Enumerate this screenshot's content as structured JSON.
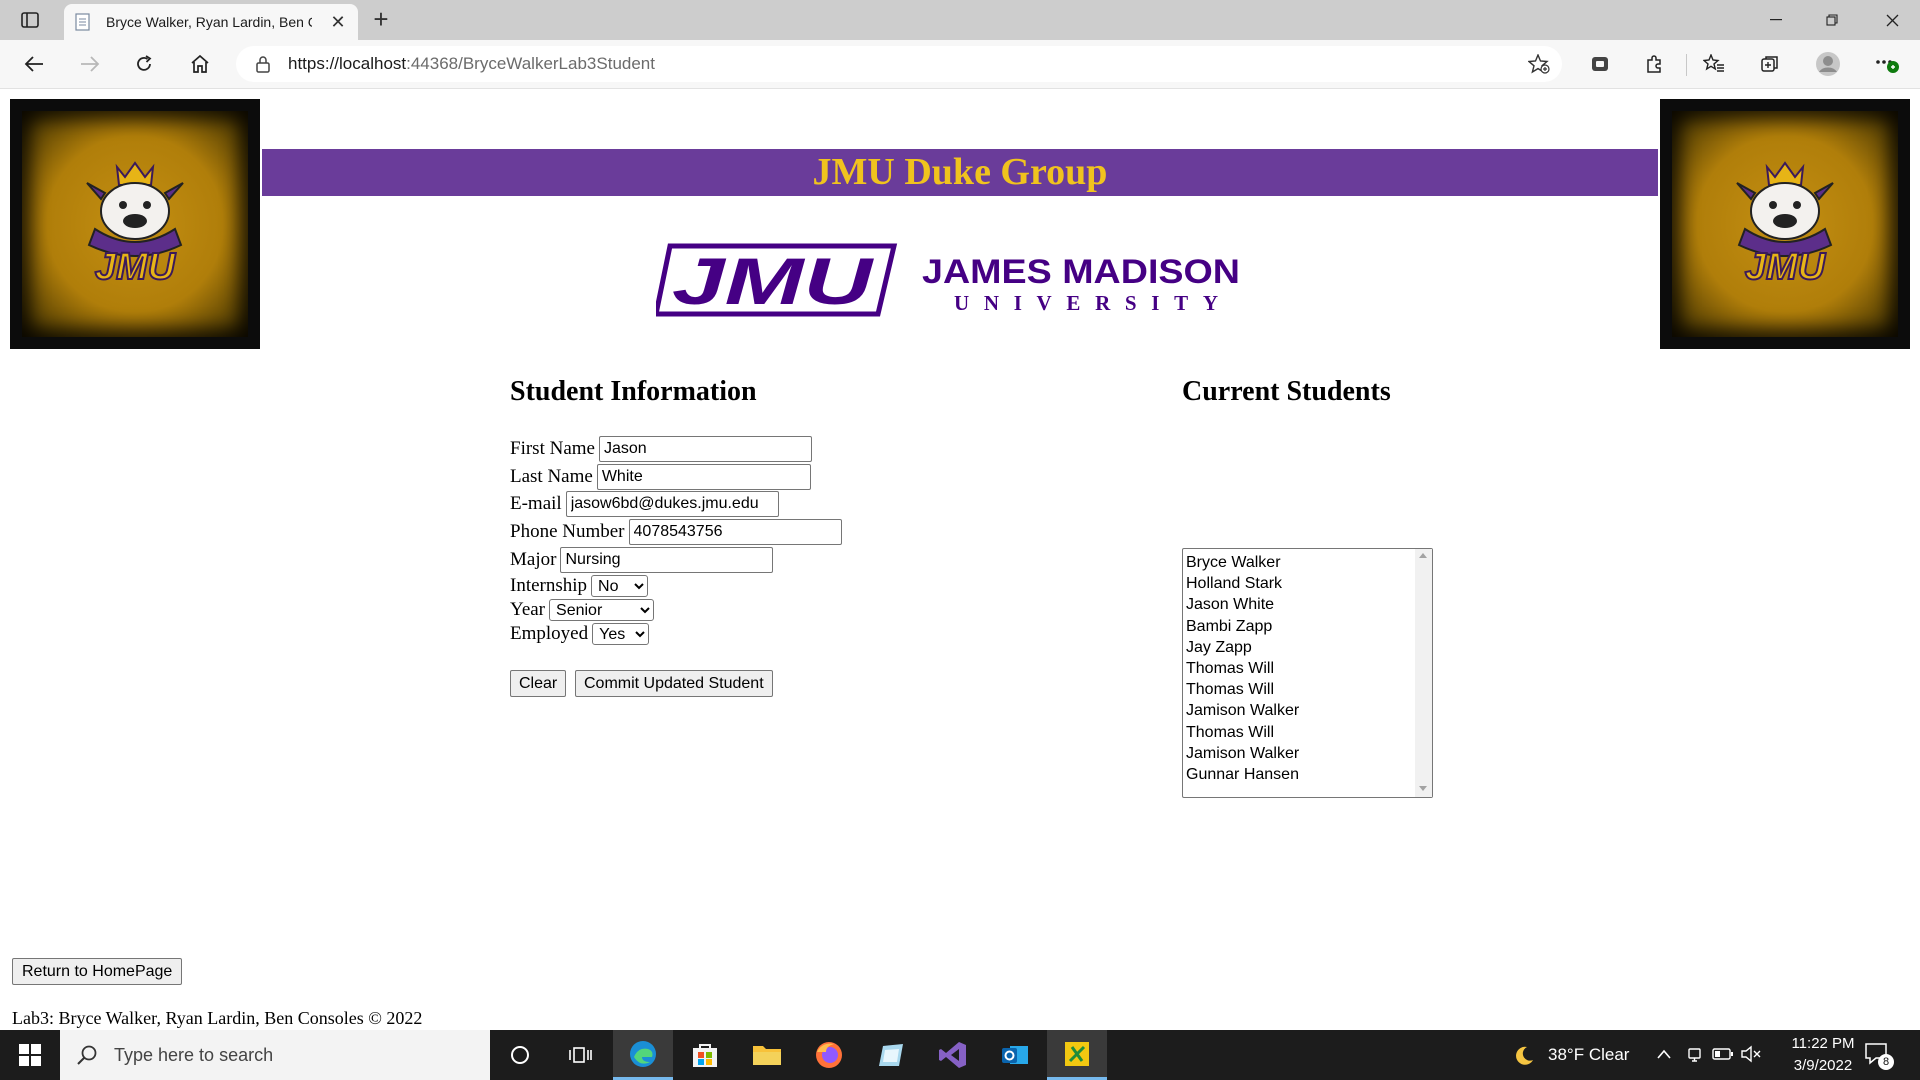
{
  "browser": {
    "tab_title": "Bryce Walker, Ryan Lardin, Ben C",
    "url_host": "https://localhost",
    "url_rest": ":44368/BryceWalkerLab3Student"
  },
  "page": {
    "banner_title": "JMU Duke Group",
    "logo_text_top": "JAMES MADISON",
    "logo_text_bottom": "UNIVERSITY",
    "logo_mark": "JMU",
    "student_info_heading": "Student Information",
    "current_students_heading": "Current Students",
    "form": {
      "first_name_label": "First Name",
      "first_name_value": "Jason",
      "last_name_label": "Last Name",
      "last_name_value": "White",
      "email_label": "E-mail",
      "email_value": "jasow6bd@dukes.jmu.edu",
      "phone_label": "Phone Number",
      "phone_value": "4078543756",
      "major_label": "Major",
      "major_value": "Nursing",
      "internship_label": "Internship",
      "internship_value": "No",
      "year_label": "Year",
      "year_value": "Senior",
      "employed_label": "Employed",
      "employed_value": "Yes"
    },
    "buttons": {
      "clear": "Clear",
      "commit": "Commit Updated Student",
      "return_home": "Return to HomePage"
    },
    "students": [
      "Bryce Walker",
      "Holland Stark",
      "Jason White",
      "Bambi Zapp",
      "Jay Zapp",
      "Thomas Will",
      "Thomas Will",
      "Jamison Walker",
      "Thomas Will",
      "Jamison Walker",
      "Gunnar Hansen"
    ],
    "footer": "Lab3: Bryce Walker, Ryan Lardin, Ben Consoles © 2022"
  },
  "taskbar": {
    "search_placeholder": "Type here to search",
    "weather": "38°F  Clear",
    "time": "11:22 PM",
    "date": "3/9/2022",
    "notification_count": "8"
  },
  "colors": {
    "purple": "#6a3c9a",
    "gold": "#f0c31e",
    "logo_purple": "#450084"
  }
}
